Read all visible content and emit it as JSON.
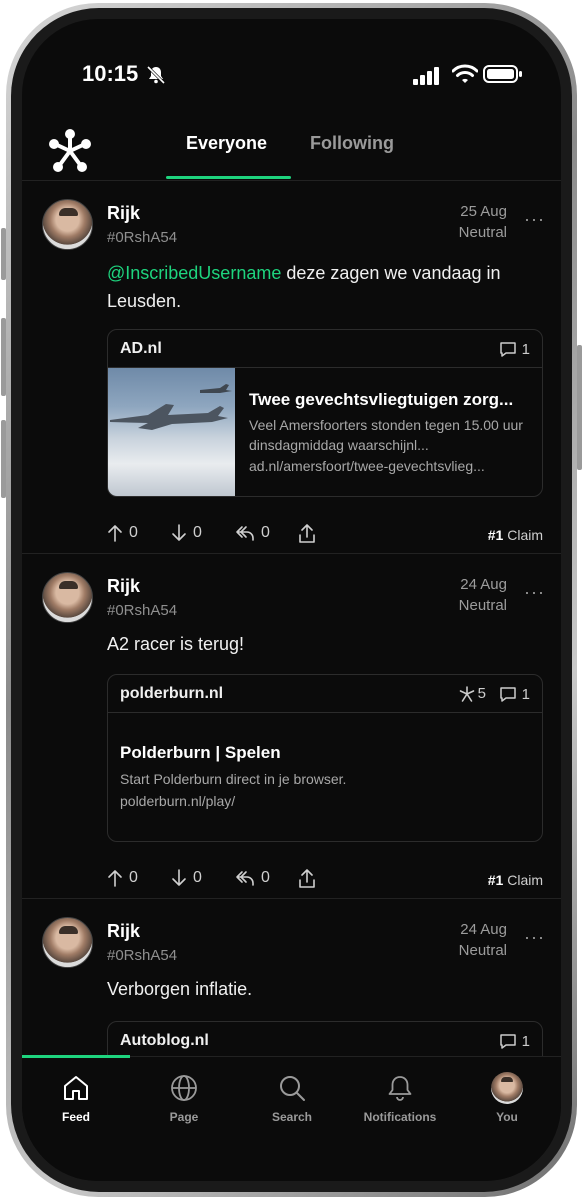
{
  "status_bar": {
    "time": "10:15"
  },
  "header": {
    "tabs": [
      {
        "label": "Everyone",
        "active": true
      },
      {
        "label": "Following",
        "active": false
      }
    ]
  },
  "posts": [
    {
      "author": "Rijk",
      "handle": "#0RshA54",
      "date": "25 Aug",
      "stance": "Neutral",
      "mention": "@InscribedUsername",
      "text": " deze zagen we vandaag in Leusden.",
      "card": {
        "domain": "AD.nl",
        "comments": "1",
        "title": "Twee gevechtsvliegtuigen zorg...",
        "description": "Veel Amersfoorters stonden tegen 15.00 uur dinsdagmiddag waarschijnl...",
        "url": "ad.nl/amersfoort/twee-gevechtsvlieg..."
      },
      "actions": {
        "up": "0",
        "down": "0",
        "share": "0",
        "claim_num": "#1",
        "claim_label": "Claim"
      }
    },
    {
      "author": "Rijk",
      "handle": "#0RshA54",
      "date": "24 Aug",
      "stance": "Neutral",
      "text": "A2 racer is terug!",
      "card": {
        "domain": "polderburn.nl",
        "stars": "5",
        "comments": "1",
        "title": "Polderburn | Spelen",
        "description": "Start Polderburn direct in je browser.",
        "url": "polderburn.nl/play/"
      },
      "actions": {
        "up": "0",
        "down": "0",
        "share": "0",
        "claim_num": "#1",
        "claim_label": "Claim"
      }
    },
    {
      "author": "Rijk",
      "handle": "#0RshA54",
      "date": "24 Aug",
      "stance": "Neutral",
      "text": "Verborgen inflatie.",
      "card": {
        "domain": "Autoblog.nl",
        "comments": "1"
      }
    }
  ],
  "tabbar": {
    "items": [
      {
        "label": "Feed",
        "icon": "home-icon",
        "active": true
      },
      {
        "label": "Page",
        "icon": "globe-icon"
      },
      {
        "label": "Search",
        "icon": "search-icon"
      },
      {
        "label": "Notifications",
        "icon": "bell-icon"
      },
      {
        "label": "You",
        "icon": "avatar"
      }
    ]
  },
  "colors": {
    "accent": "#1ed47e",
    "background": "#0b0b0b",
    "muted": "#9c9c9c"
  }
}
